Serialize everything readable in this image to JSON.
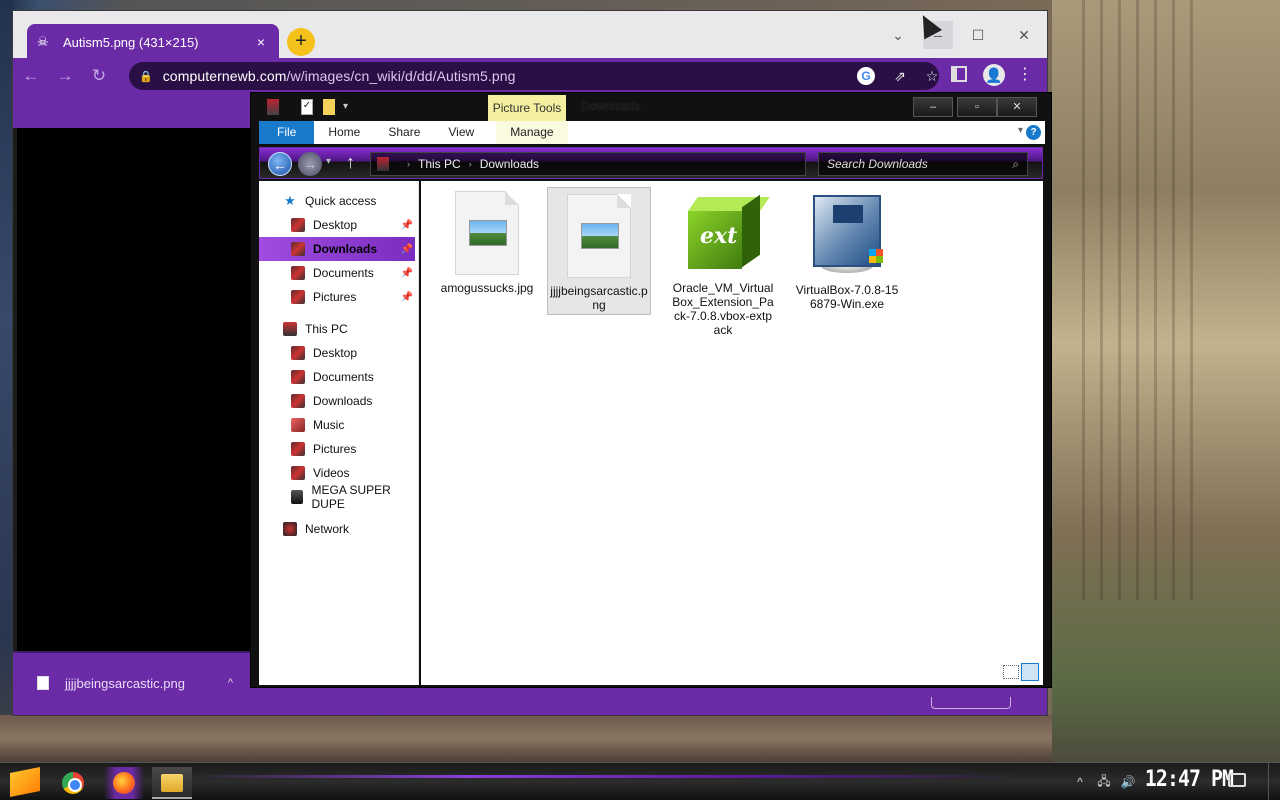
{
  "chrome": {
    "tab": {
      "title": "Autism5.png (431×215)",
      "favicon": "skull-icon",
      "close": "×"
    },
    "new_tab": "+",
    "window_controls": {
      "tab_search": "⌄",
      "minimize": "–",
      "maximize": "☐",
      "close": "✕"
    },
    "nav": {
      "back": "←",
      "forward": "→",
      "reload": "↻"
    },
    "omnibox": {
      "url_host": "computernewb.com",
      "url_path": "/w/images/cn_wiki/d/dd/Autism5.png"
    },
    "toolbar_icons": {
      "google": "G",
      "share": "⇗",
      "star": "☆",
      "profile": "👤",
      "menu": "⋮"
    },
    "download_shelf": {
      "filename": "jjjjbeingsarcastic.png",
      "chevron": "^"
    }
  },
  "explorer": {
    "title": "Downloads",
    "contextual_tab": "Picture Tools",
    "ribbon_tabs": {
      "file": "File",
      "home": "Home",
      "share": "Share",
      "view": "View",
      "manage": "Manage"
    },
    "help": "?",
    "window_controls": {
      "minimize": "–",
      "maximize": "▫",
      "close": "✕"
    },
    "address": {
      "root": "This PC",
      "current": "Downloads",
      "separator": "›"
    },
    "search_placeholder": "Search Downloads",
    "search_icon": "⌕",
    "nav_pane": {
      "quick_access": "Quick access",
      "quick_items": [
        {
          "label": "Desktop",
          "pinned": true
        },
        {
          "label": "Downloads",
          "pinned": true,
          "selected": true
        },
        {
          "label": "Documents",
          "pinned": true
        },
        {
          "label": "Pictures",
          "pinned": true
        }
      ],
      "this_pc": "This PC",
      "pc_items": [
        {
          "label": "Desktop"
        },
        {
          "label": "Documents"
        },
        {
          "label": "Downloads"
        },
        {
          "label": "Music"
        },
        {
          "label": "Pictures"
        },
        {
          "label": "Videos"
        },
        {
          "label": "MEGA SUPER DUPE"
        }
      ],
      "network": "Network"
    },
    "files": [
      {
        "name": "amogussucks.jpg",
        "type": "image"
      },
      {
        "name": "jjjjbeingsarcastic.png",
        "type": "image",
        "selected": true
      },
      {
        "name": "Oracle_VM_VirtualBox_Extension_Pack-7.0.8.vbox-extpack",
        "type": "extpack",
        "icon_text": "ext"
      },
      {
        "name": "VirtualBox-7.0.8-156879-Win.exe",
        "type": "installer"
      }
    ]
  },
  "taskbar": {
    "apps": [
      "start-icon",
      "chrome-icon",
      "firefox-icon",
      "file-explorer-icon"
    ],
    "tray": {
      "chevron": "^",
      "network": "🖧",
      "volume": "🔊"
    },
    "clock": "12:47 PM"
  },
  "colors": {
    "accent_purple": "#6b2aa6",
    "ribbon_file_blue": "#1979ca",
    "picture_tools_yellow": "#f4f0a0"
  }
}
